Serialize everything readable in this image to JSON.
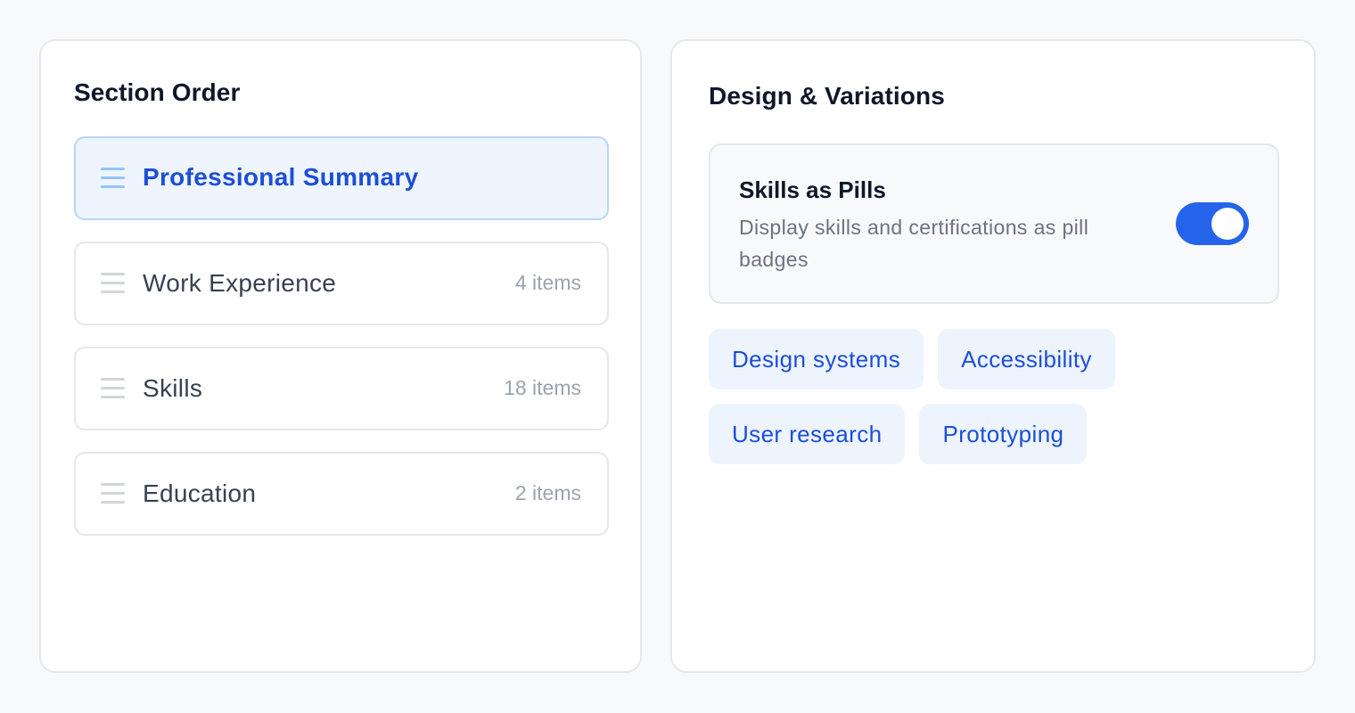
{
  "section_order": {
    "title": "Section Order",
    "sections": [
      {
        "label": "Professional Summary",
        "count": "",
        "active": true
      },
      {
        "label": "Work Experience",
        "count": "4 items",
        "active": false
      },
      {
        "label": "Skills",
        "count": "18 items",
        "active": false
      },
      {
        "label": "Education",
        "count": "2 items",
        "active": false
      }
    ]
  },
  "design": {
    "title": "Design & Variations",
    "toggle": {
      "title": "Skills as Pills",
      "description": "Display skills and certifications as pill badges",
      "enabled": true
    },
    "pills": [
      [
        "Design systems",
        "Accessibility"
      ],
      [
        "User research",
        "Prototyping"
      ]
    ]
  },
  "colors": {
    "accent": "#2563eb",
    "accent_text": "#1d4ed8",
    "active_bg": "#eef5fe",
    "pill_bg": "#edf4fe"
  },
  "icons": {
    "drag_handle": "drag-handle-icon"
  }
}
